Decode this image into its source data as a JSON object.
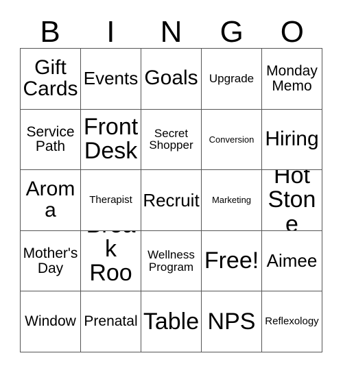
{
  "card": {
    "header_letters": [
      "B",
      "I",
      "N",
      "G",
      "O"
    ],
    "rows": [
      [
        {
          "label": "Gift Cards",
          "size": "xl"
        },
        {
          "label": "Events",
          "size": "lg"
        },
        {
          "label": "Goals",
          "size": "xl"
        },
        {
          "label": "Upgrade",
          "size": "sm"
        },
        {
          "label": "Monday Memo",
          "size": "md"
        }
      ],
      [
        {
          "label": "Service Path",
          "size": "md"
        },
        {
          "label": "Front Desk",
          "size": "xxl"
        },
        {
          "label": "Secret Shopper",
          "size": "sm"
        },
        {
          "label": "Conversion",
          "size": "xxs"
        },
        {
          "label": "Hiring",
          "size": "xl"
        }
      ],
      [
        {
          "label": "Aroma",
          "size": "xl"
        },
        {
          "label": "Therapist",
          "size": "xs"
        },
        {
          "label": "Recruit",
          "size": "lg"
        },
        {
          "label": "Marketing",
          "size": "xxs"
        },
        {
          "label": "Hot Stone",
          "size": "xxl"
        }
      ],
      [
        {
          "label": "Mother's Day",
          "size": "md"
        },
        {
          "label": "Break Room",
          "size": "xxl"
        },
        {
          "label": "Wellness Program",
          "size": "sm"
        },
        {
          "label": "Free!",
          "size": "xxl"
        },
        {
          "label": "Aimee",
          "size": "lg"
        }
      ],
      [
        {
          "label": "Window",
          "size": "md"
        },
        {
          "label": "Prenatal",
          "size": "md"
        },
        {
          "label": "Table",
          "size": "xxl"
        },
        {
          "label": "NPS",
          "size": "xxl"
        },
        {
          "label": "Reflexology",
          "size": "xs"
        }
      ]
    ],
    "free_space_label": "Free!",
    "colors": {
      "background": "#ffffff",
      "text": "#000000",
      "grid_line": "#555555"
    }
  }
}
